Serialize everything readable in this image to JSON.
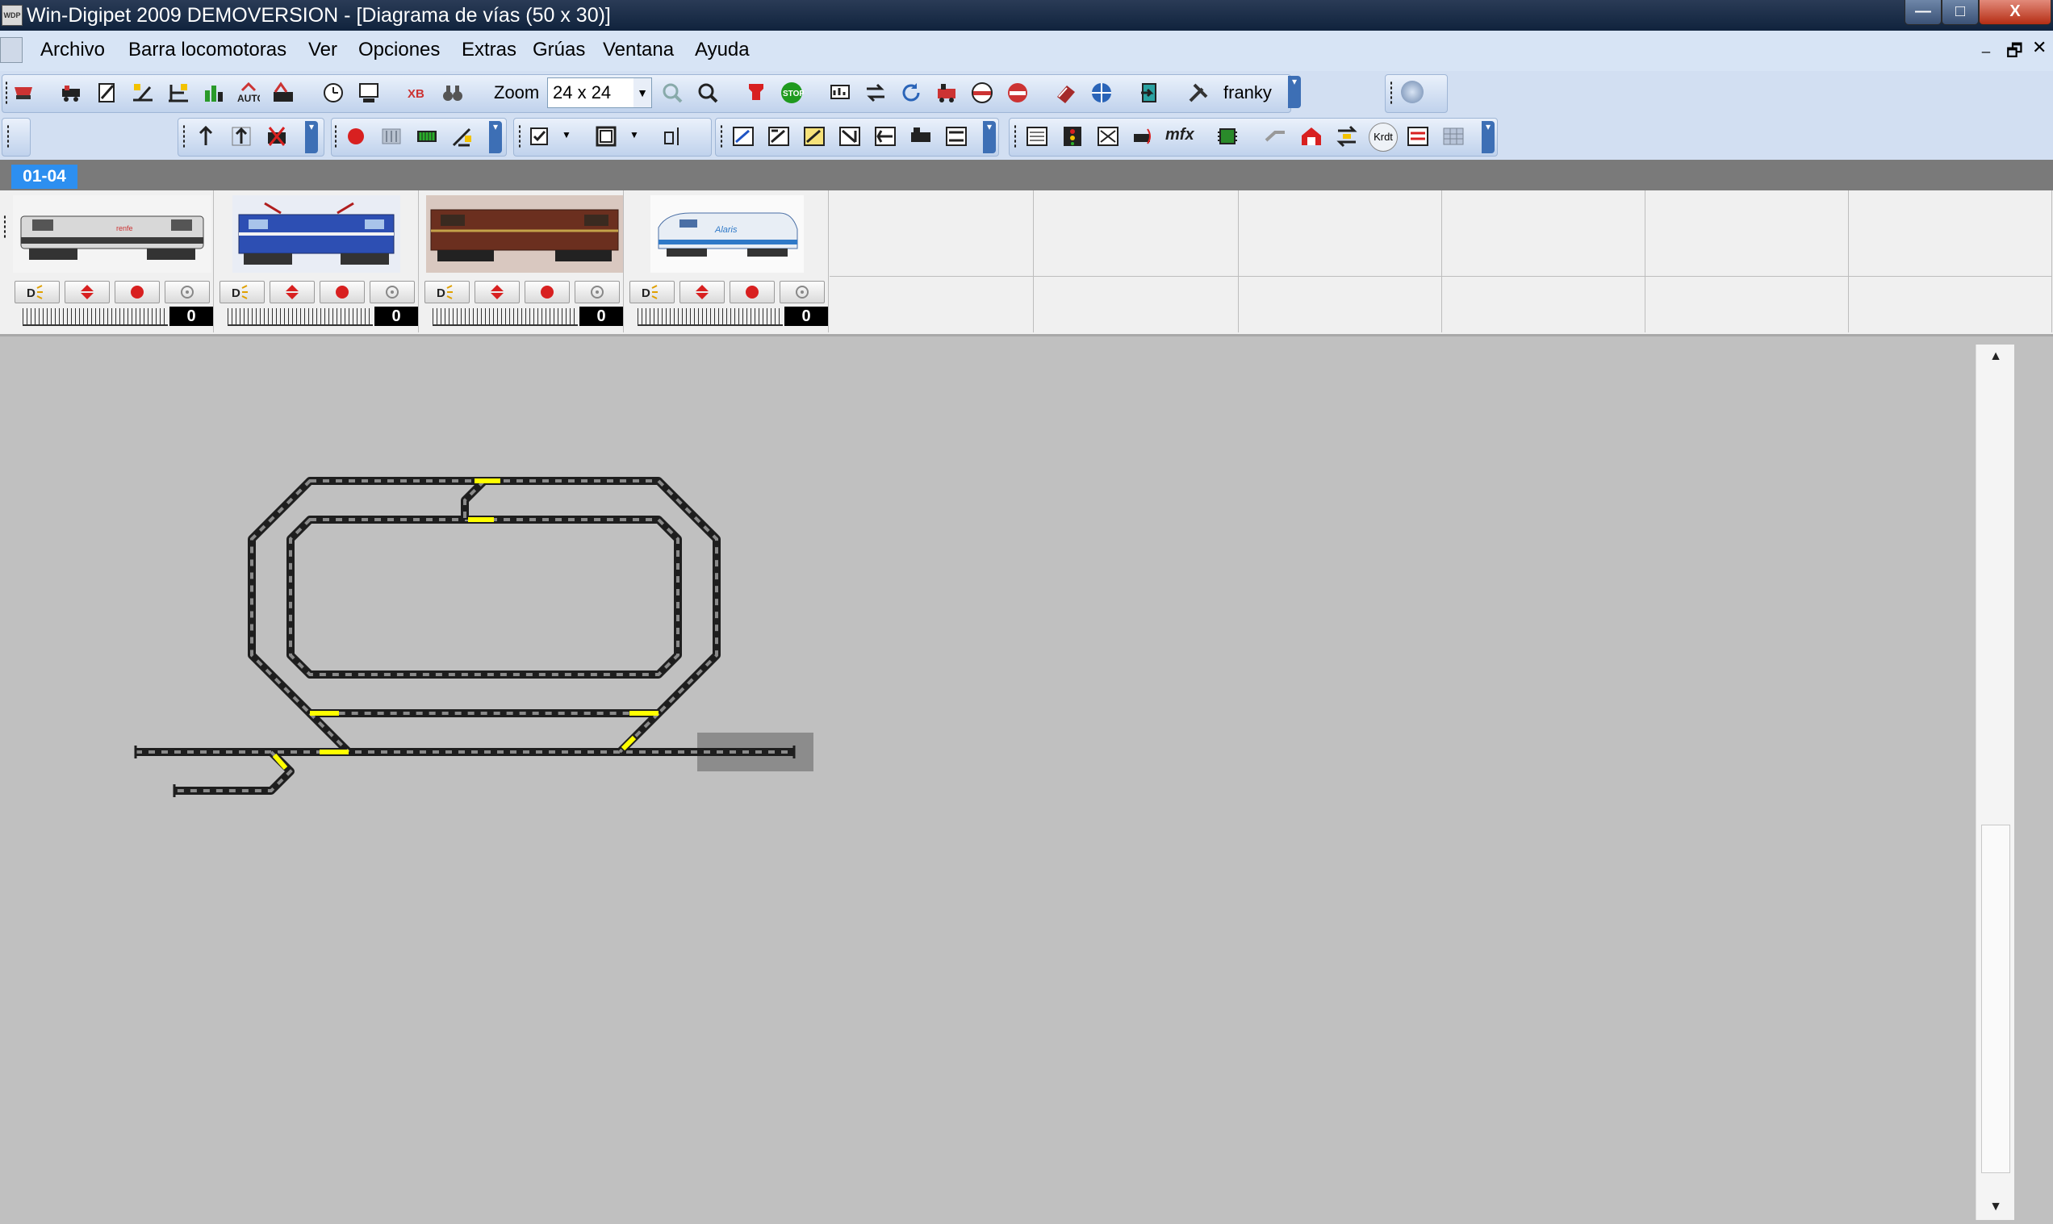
{
  "window": {
    "title": "Win-Digipet 2009 DEMOVERSION - [Diagrama de vías (50 x 30)]",
    "app_icon_text": "WDP",
    "minimize": "—",
    "maximize": "□",
    "close": "X"
  },
  "menu": {
    "items": [
      "Archivo",
      "Barra locomotoras",
      "Ver",
      "Opciones",
      "Extras",
      "Grúas",
      "Ventana",
      "Ayuda"
    ],
    "mdi_restore": "🗗",
    "mdi_close": "✕"
  },
  "toolbar": {
    "zoom_label": "Zoom",
    "zoom_value": "24 x 24",
    "user_name": "franky",
    "mfx_label": "mfx",
    "krdt_label": "Krdt",
    "stop_label": "STOP"
  },
  "loco_bar": {
    "tab_label": "01-04",
    "slots": [
      {
        "speed": "0",
        "loco_image": "grey-white-diesel-locomotive"
      },
      {
        "speed": "0",
        "loco_image": "blue-electric-locomotive"
      },
      {
        "speed": "0",
        "loco_image": "brown-diesel-locomotive"
      },
      {
        "speed": "0",
        "loco_image": "white-alaris-locomotive"
      }
    ],
    "empty_slots": 6
  },
  "colors": {
    "track": "#1e1e1e",
    "track_sleeper": "#8a8a8a",
    "turnout_highlight": "#ffff00",
    "canvas_bg": "#c0c0c0",
    "selection": "#8c8c8c",
    "tab_accent": "#2d8ff0"
  }
}
